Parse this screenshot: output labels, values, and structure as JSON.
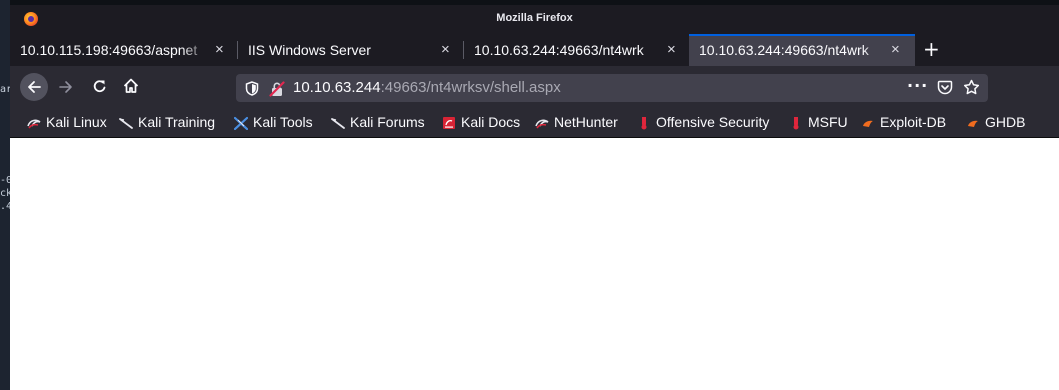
{
  "window": {
    "title": "Mozilla Firefox"
  },
  "tabs": [
    {
      "label": "10.10.115.198:49663/aspnet",
      "active": false
    },
    {
      "label": "IIS Windows Server",
      "active": false
    },
    {
      "label": "10.10.63.244:49663/nt4wrk",
      "active": false
    },
    {
      "label": "10.10.63.244:49663/nt4wrk",
      "active": true
    }
  ],
  "new_tab_label": "+",
  "close_label": "×",
  "address": {
    "host": "10.10.63.244",
    "rest": ":49663/nt4wrksv/shell.aspx",
    "more": "···"
  },
  "bookmarks": [
    {
      "label": "Kali Linux",
      "icon": "kali-dragon-icon"
    },
    {
      "label": "Kali Training",
      "icon": "kali-training-icon"
    },
    {
      "label": "Kali Tools",
      "icon": "kali-tools-icon"
    },
    {
      "label": "Kali Forums",
      "icon": "kali-forums-icon"
    },
    {
      "label": "Kali Docs",
      "icon": "kali-docs-icon"
    },
    {
      "label": "NetHunter",
      "icon": "nethunter-icon"
    },
    {
      "label": "Offensive Security",
      "icon": "offsec-icon"
    },
    {
      "label": "MSFU",
      "icon": "msfu-icon"
    },
    {
      "label": "Exploit-DB",
      "icon": "exploitdb-icon"
    },
    {
      "label": "GHDB",
      "icon": "ghdb-icon"
    }
  ],
  "terminal_fragments": [
    "ar",
    "-0",
    "ck",
    ".4"
  ],
  "colors": {
    "tab_active_bg": "#42414d",
    "toolbar_bg": "#2b2a33",
    "titlebar_bg": "#1c1b22",
    "accent": "#0060df",
    "page_bg": "#ffffff"
  }
}
